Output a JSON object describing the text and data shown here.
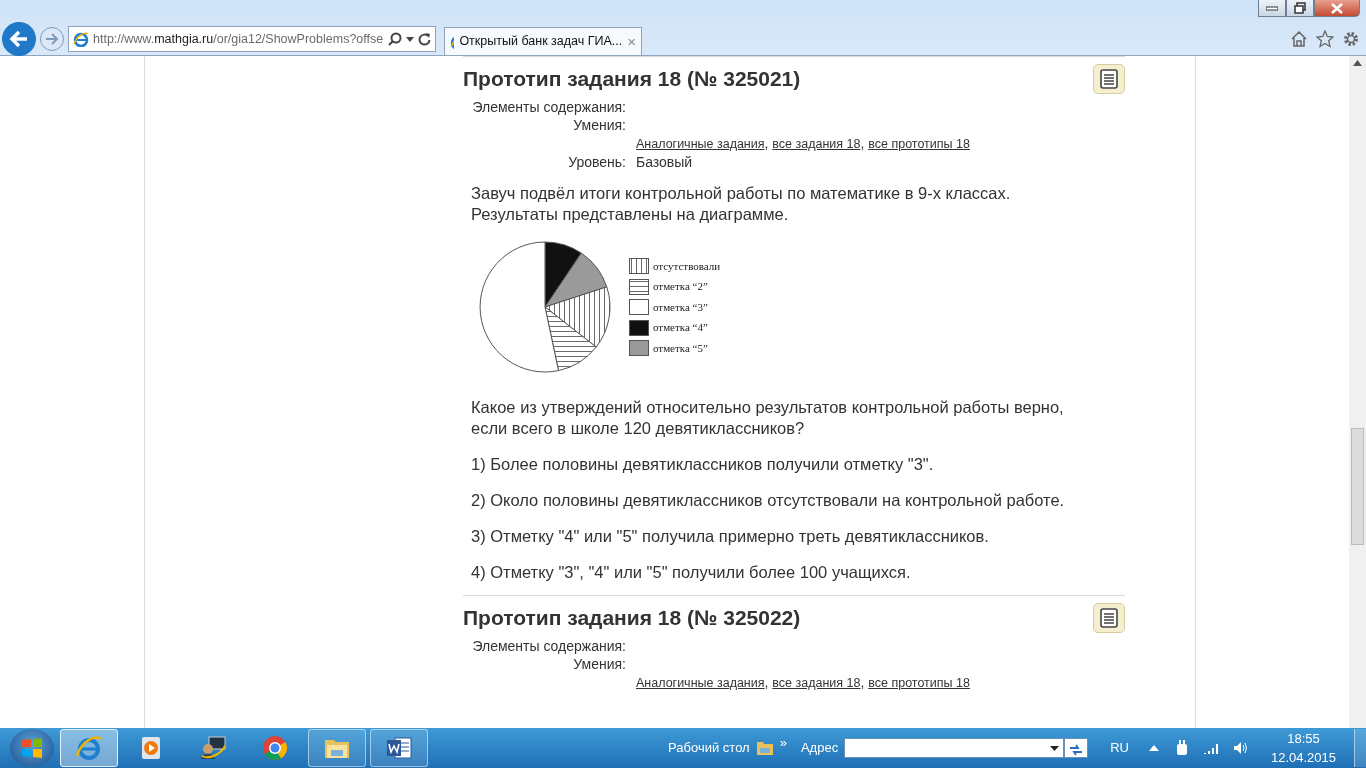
{
  "browser": {
    "address": "http://www.**mathgia.ru**/or/gia12/ShowProblems?offse",
    "tab_title": "Открытый банк задач ГИА...",
    "tab_close": "×"
  },
  "problems": [
    {
      "title": "Прототип задания 18 (№ 325021)",
      "meta": [
        {
          "label": "Элементы содержания:"
        },
        {
          "label": "Умения:"
        }
      ],
      "links": [
        "Аналогичные задания",
        "все задания 18",
        "все прототипы 18"
      ],
      "link_separators": [
        ",",
        ","
      ],
      "level_label": "Уровень:",
      "level_value": "Базовый",
      "intro": "Завуч подвёл итоги контрольной работы по математике в 9-х классах. Результаты представлены на диаграмме.",
      "figure": {
        "legend": [
          {
            "label": "отсутствовали",
            "kind": "vertical"
          },
          {
            "label": "отметка “2”",
            "kind": "horizontal"
          },
          {
            "label": "отметка “3”",
            "kind": "white"
          },
          {
            "label": "отметка “4”",
            "kind": "black"
          },
          {
            "label": "отметка “5”",
            "kind": "grey"
          }
        ]
      },
      "question": "Какое из утверждений относительно результатов контрольной работы верно, если всего в школе 120 девятиклассников?",
      "options": [
        "1) Более половины девятиклассников получили отметку \"3\".",
        "2) Около половины девятиклассников отсутствовали на контрольной работе.",
        "3) Отметку \"4\" или \"5\" получила примерно треть девятиклассников.",
        "4) Отметку \"3\", \"4\" или \"5\" получили более 100 учащихся."
      ]
    },
    {
      "title": "Прототип задания 18 (№ 325022)",
      "meta": [
        {
          "label": "Элементы содержания:"
        },
        {
          "label": "Умения:"
        }
      ],
      "links": [
        "Аналогичные задания",
        "все задания 18",
        "все прототипы 18"
      ],
      "link_separators": [
        ",",
        ","
      ]
    }
  ],
  "taskbar": {
    "apps": [
      {
        "kind": "ie",
        "open": true,
        "selected": true
      },
      {
        "kind": "media",
        "open": false,
        "selected": false
      },
      {
        "kind": "remote",
        "open": false,
        "selected": false
      },
      {
        "kind": "chrome",
        "open": false,
        "selected": false
      },
      {
        "kind": "folder",
        "open": true,
        "selected": false
      },
      {
        "kind": "word",
        "open": true,
        "selected": false
      }
    ],
    "desktop_label": "Рабочий стол",
    "chevron": "»",
    "address_label": "Адрес",
    "language": "RU",
    "time": "18:55",
    "date": "12.04.2015"
  }
}
